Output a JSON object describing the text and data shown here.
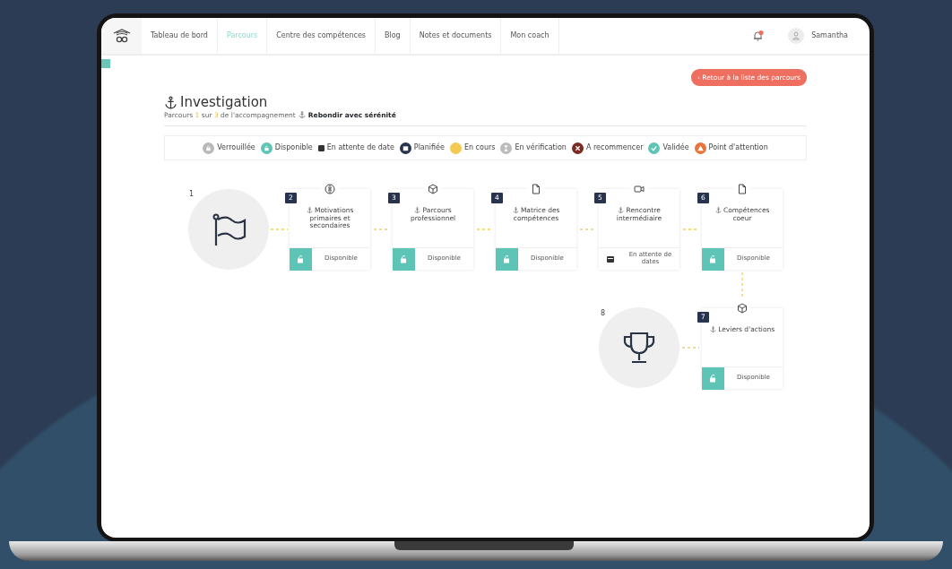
{
  "nav": {
    "items": [
      {
        "label": "Tableau de bord",
        "selected": false
      },
      {
        "label": "Parcours",
        "selected": true
      },
      {
        "label": "Centre des compétences",
        "selected": false
      },
      {
        "label": "Blog",
        "selected": false
      },
      {
        "label": "Notes et documents",
        "selected": false
      },
      {
        "label": "Mon coach",
        "selected": false
      }
    ],
    "user": "Samantha"
  },
  "back_button": "‹ Retour à la liste des parcours",
  "title": "Investigation",
  "subtitle": {
    "prefix": "Parcours",
    "current": "1",
    "middle": "sur",
    "total": "3",
    "suffix": "de l'accompagnement",
    "program": "Rebondir avec sérénité"
  },
  "legend": [
    {
      "kind": "locked",
      "label": "Verrouillée",
      "color": "#b9b9b9"
    },
    {
      "kind": "available",
      "label": "Disponible",
      "color": "#5ec4b6"
    },
    {
      "kind": "waiting",
      "label": "En attente de date",
      "color": "#333333"
    },
    {
      "kind": "planned",
      "label": "Planifiée",
      "color": "#28344e"
    },
    {
      "kind": "in_progress",
      "label": "En cours",
      "color": "#f3c94f"
    },
    {
      "kind": "verifying",
      "label": "En vérification",
      "color": "#bcbcbc"
    },
    {
      "kind": "redo",
      "label": "A recommencer",
      "color": "#7c2a22"
    },
    {
      "kind": "validated",
      "label": "Validée",
      "color": "#5ec4b6"
    },
    {
      "kind": "attention",
      "label": "Point d'attention",
      "color": "#e8743b"
    }
  ],
  "start": {
    "number": "1"
  },
  "steps": [
    {
      "number": "2",
      "title": "Motivations primaires et secondaires",
      "kind": "available",
      "status": "Disponible"
    },
    {
      "number": "3",
      "title": "Parcours professionnel",
      "kind": "available",
      "status": "Disponible"
    },
    {
      "number": "4",
      "title": "Matrice des compétences",
      "kind": "available",
      "status": "Disponible"
    },
    {
      "number": "5",
      "title": "Rencontre intermédiaire",
      "kind": "waiting",
      "status": "En attente de dates"
    },
    {
      "number": "6",
      "title": "Compétences coeur",
      "kind": "available",
      "status": "Disponible"
    },
    {
      "number": "7",
      "title": "Leviers d'actions",
      "kind": "available",
      "status": "Disponible"
    }
  ],
  "finish": {
    "number": "8"
  }
}
